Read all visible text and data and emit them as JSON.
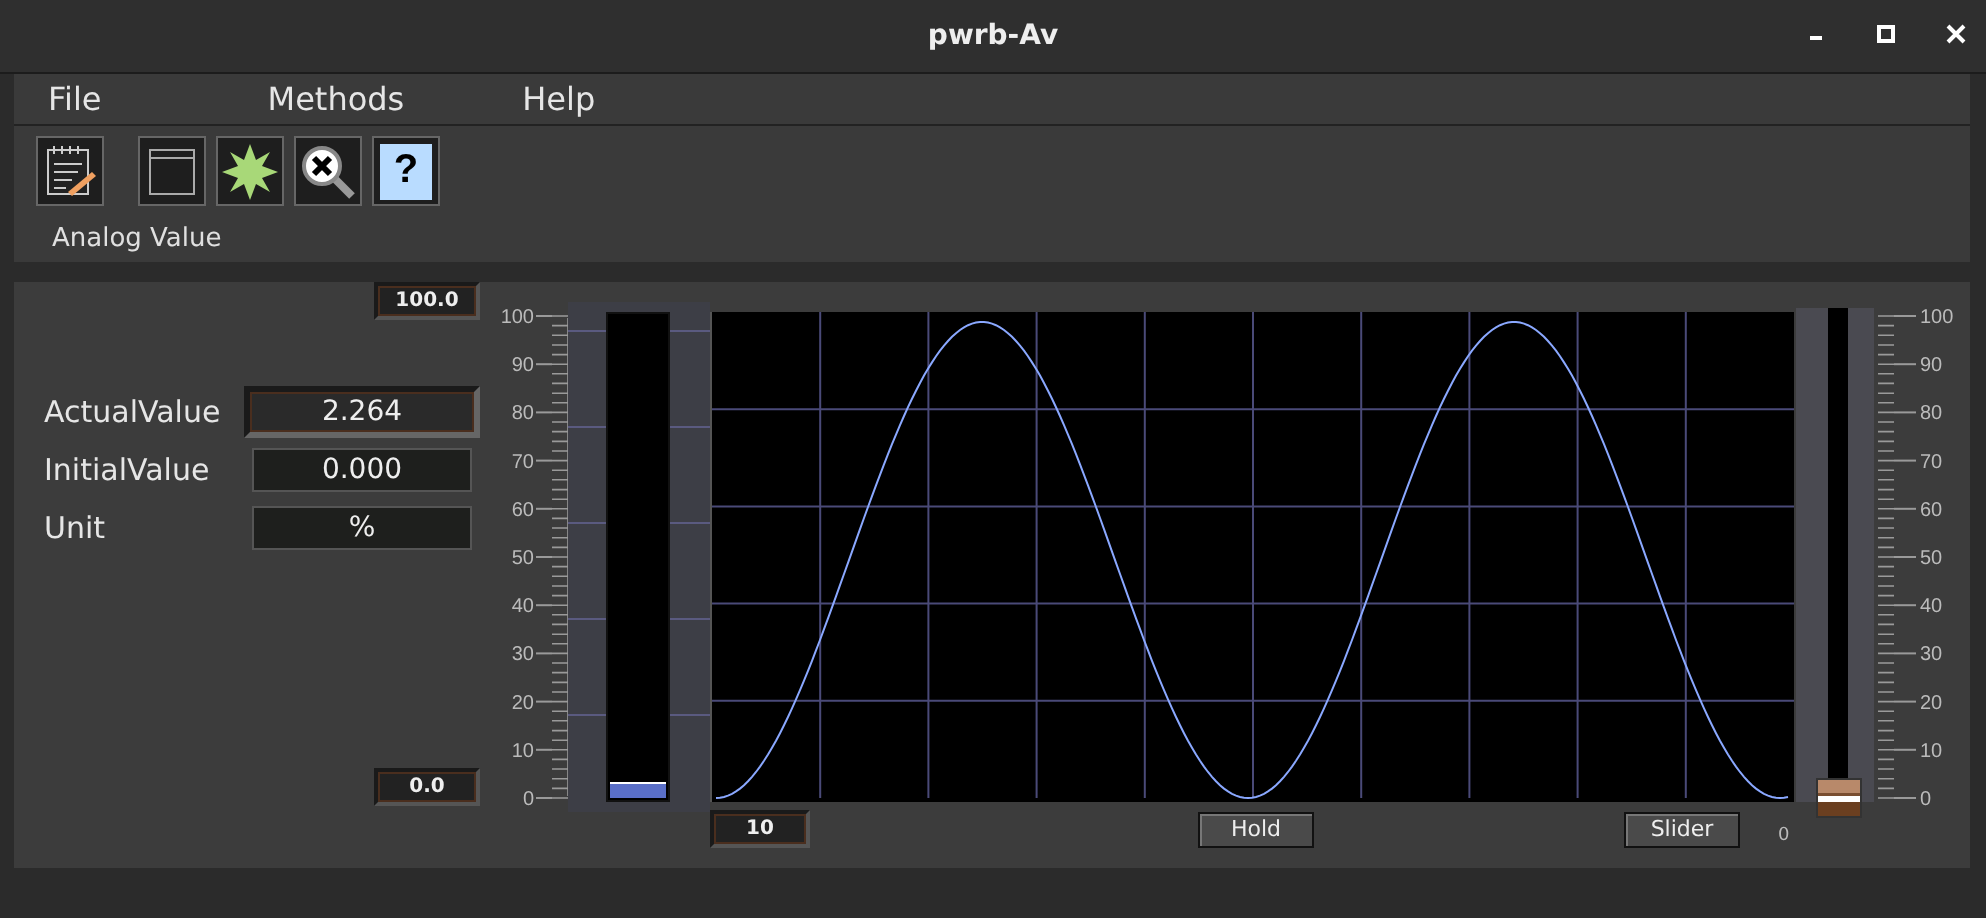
{
  "window": {
    "title": "pwrb-Av"
  },
  "menu": [
    {
      "label": "File"
    },
    {
      "label": "Methods"
    },
    {
      "label": "Help"
    }
  ],
  "toolbar": {
    "buttons": [
      {
        "kind": "notepad"
      },
      {
        "kind": "window"
      },
      {
        "kind": "star"
      },
      {
        "kind": "zoom-reset"
      },
      {
        "kind": "help",
        "glyph": "?"
      }
    ],
    "caption": "Analog Value"
  },
  "panel": {
    "max_value": "100.0",
    "min_value": "0.0",
    "fields": [
      {
        "label": "ActualValue",
        "value": "2.264",
        "kind": "raised"
      },
      {
        "label": "InitialValue",
        "value": "0.000",
        "kind": "flat"
      },
      {
        "label": "Unit",
        "value": "%",
        "kind": "flat"
      }
    ],
    "left_scale": [
      "100",
      "90",
      "80",
      "70",
      "60",
      "50",
      "40",
      "30",
      "20",
      "10",
      "0"
    ],
    "bar": {
      "level": 0.023
    },
    "trend": {
      "time_range": "10",
      "buttons": [
        {
          "label": "Hold"
        },
        {
          "label": "Slider"
        }
      ],
      "slider_min": "0"
    },
    "slider": {
      "level": 0.04
    },
    "right_scale": [
      "100",
      "90",
      "80",
      "70",
      "60",
      "50",
      "40",
      "30",
      "20",
      "10",
      "0"
    ]
  }
}
